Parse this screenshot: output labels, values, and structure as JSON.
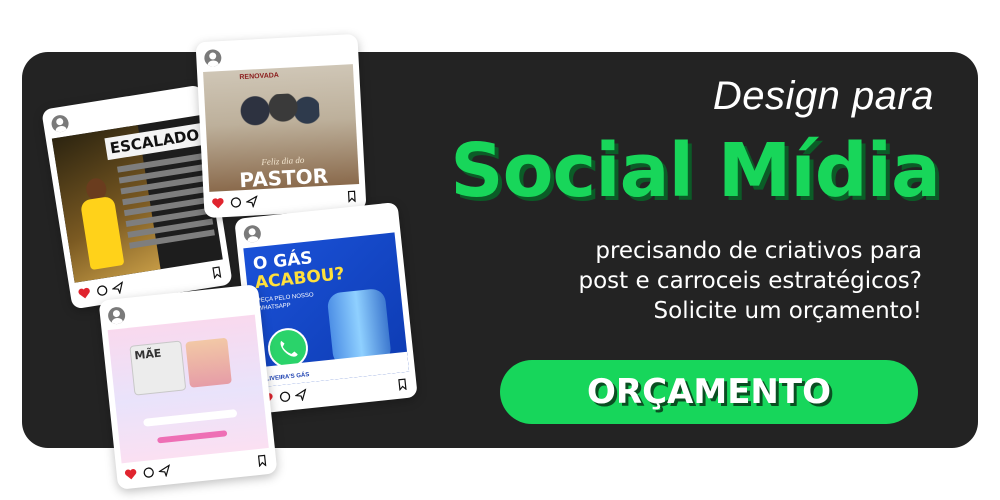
{
  "heading": {
    "line1": "Design para",
    "line2": "Social Mídia"
  },
  "subtext": {
    "line1": "precisando de criativos para",
    "line2": "post e carroceis estratégicos?",
    "line3": "Solicite um orçamento!"
  },
  "cta": {
    "label": "ORÇAMENTO"
  },
  "posts": [
    {
      "name": "escalado",
      "title": "ESCALADO"
    },
    {
      "name": "pastor",
      "subtitle": "Feliz dia do",
      "title": "PASTOR",
      "logo": "RENOVADA"
    },
    {
      "name": "gas",
      "title_line1": "O GÁS",
      "title_line2": "ACABOU?",
      "subtitle": "PEÇA PELO NOSSO WHATSAPP",
      "brand": "OLIVEIRA'S GÁS"
    },
    {
      "name": "mae",
      "title": "MÃE"
    }
  ],
  "colors": {
    "panel": "#232323",
    "accent_green": "#18d65a",
    "text_white": "#ffffff",
    "icon_heart": "#e0242e"
  },
  "icons": [
    "user-avatar-icon",
    "heart-icon",
    "comment-icon",
    "share-icon",
    "bookmark-icon",
    "whatsapp-icon"
  ]
}
